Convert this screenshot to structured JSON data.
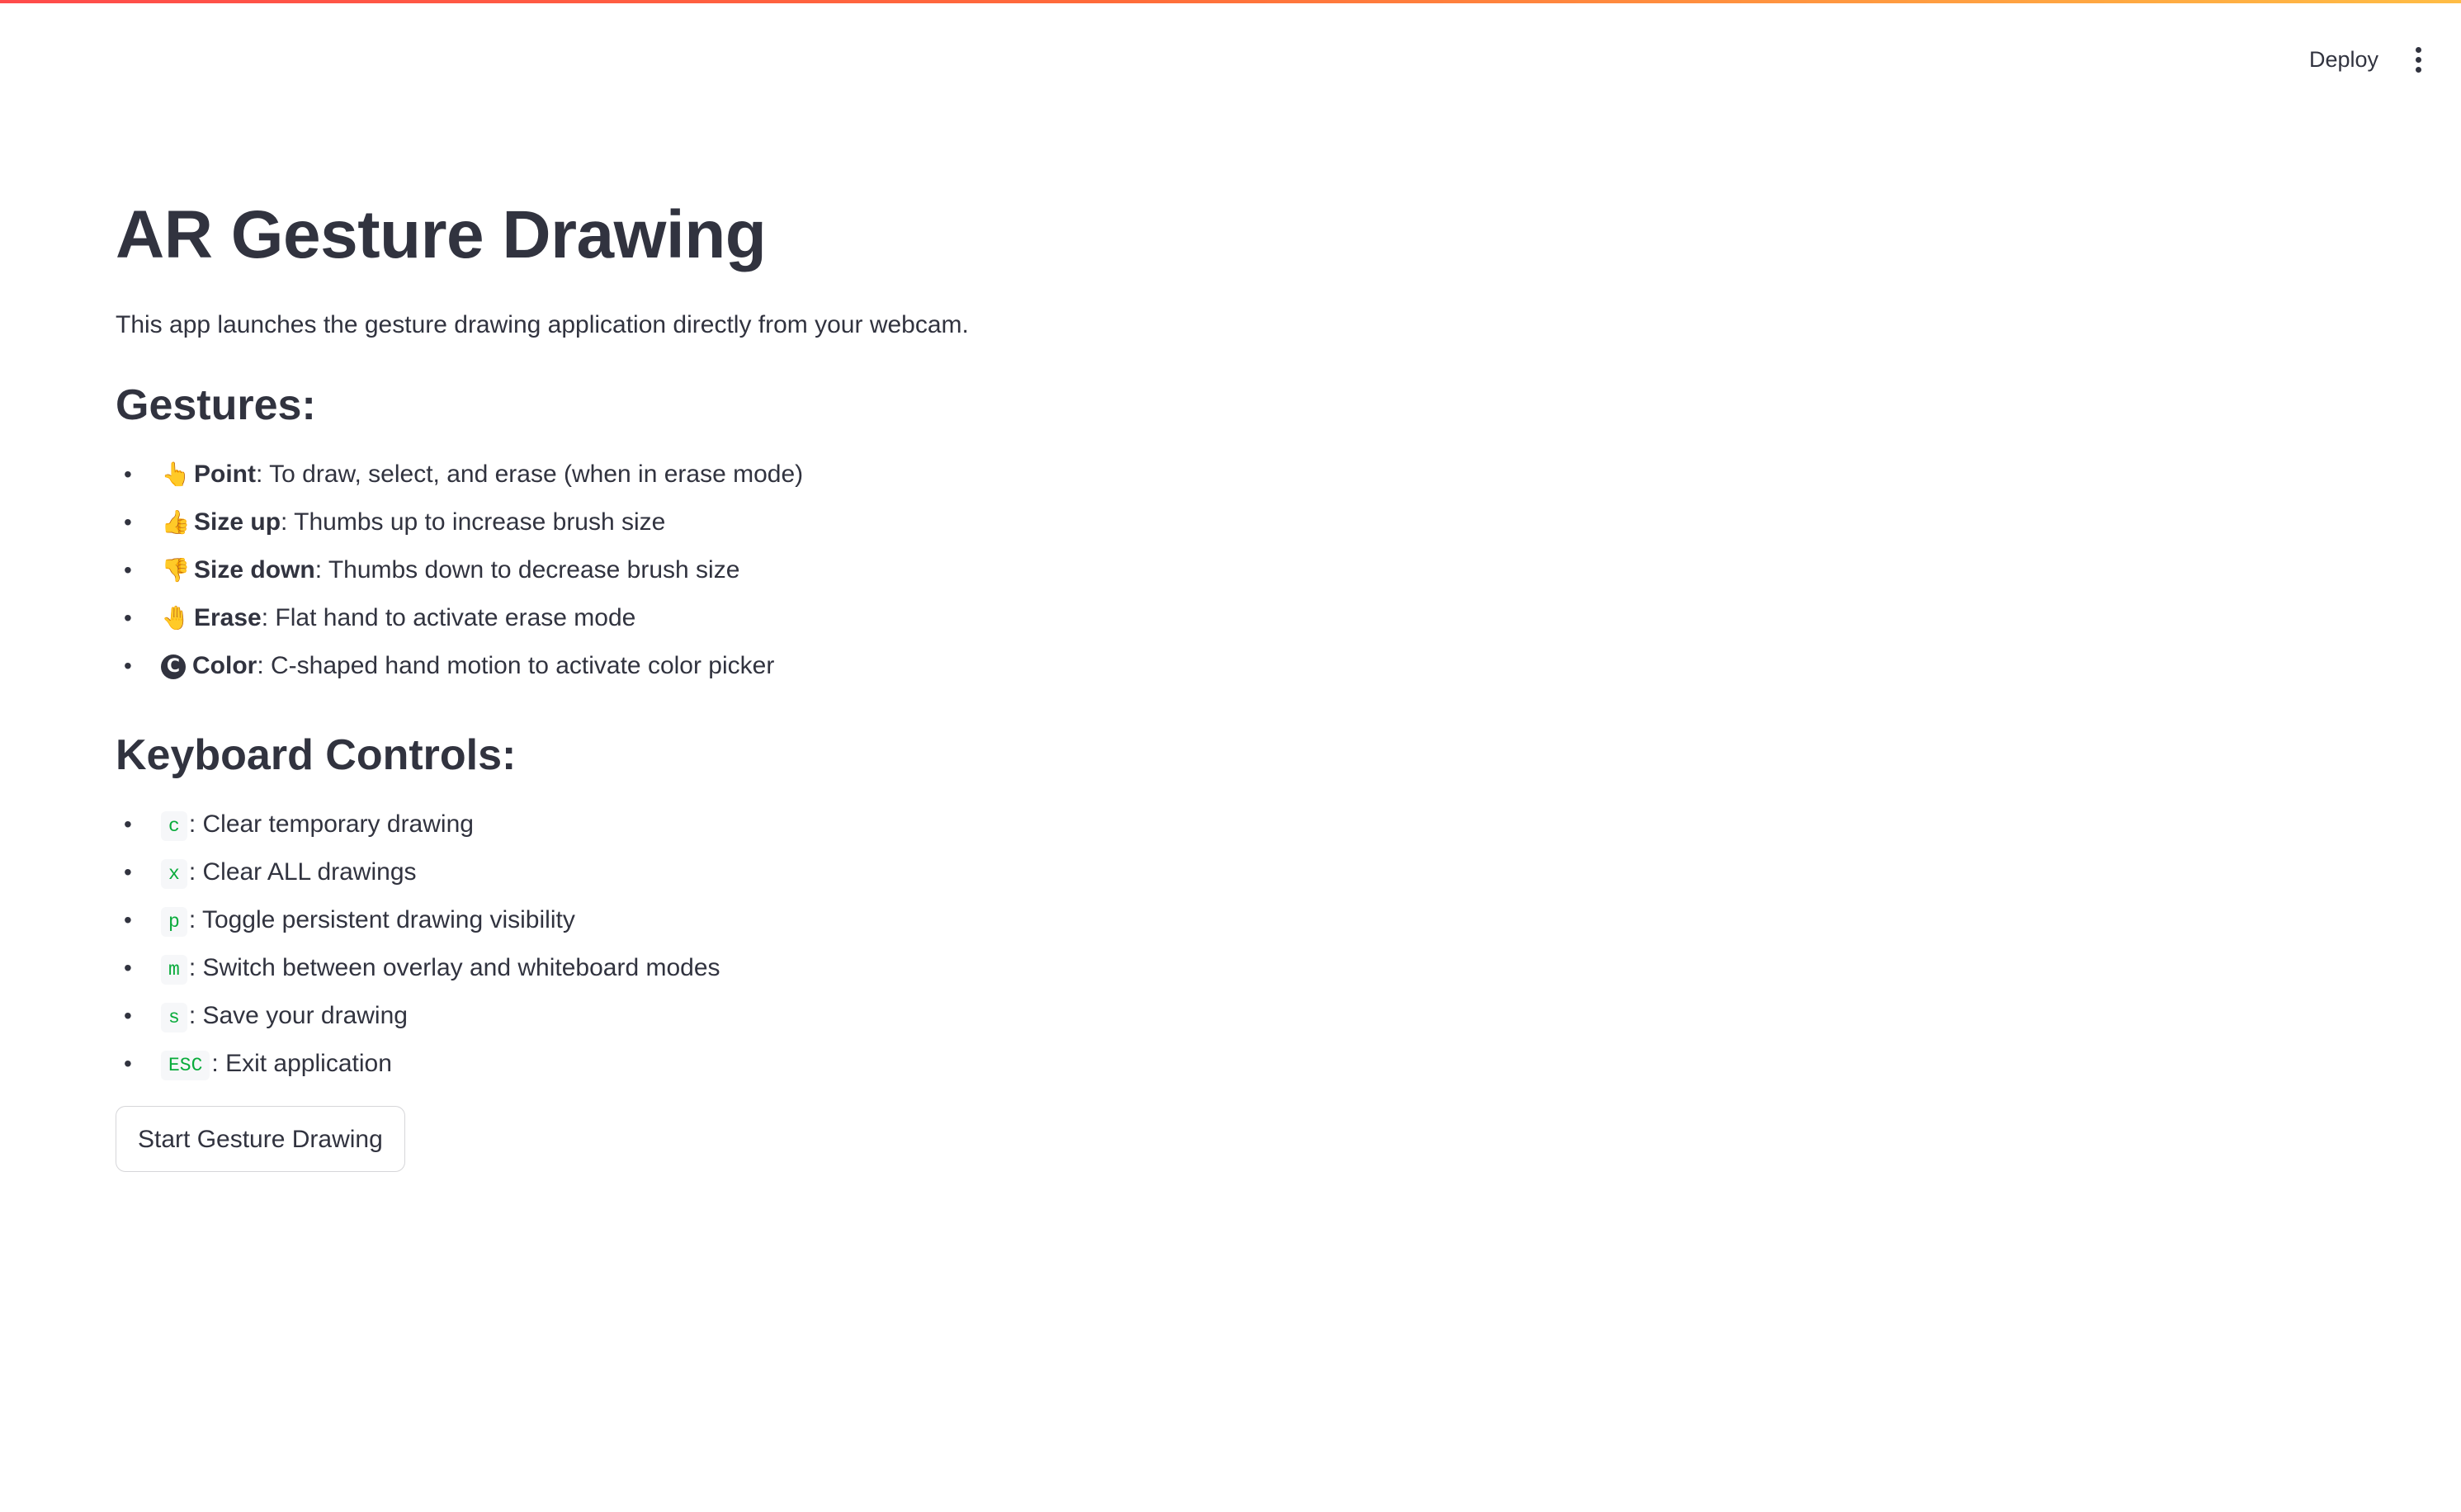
{
  "header": {
    "deploy_label": "Deploy",
    "menu_icon": "more-vertical-icon"
  },
  "colors": {
    "text": "#31333f",
    "code_green": "#09ab3b",
    "decoration_start": "#ff4b4b",
    "decoration_end": "#ffbd45"
  },
  "main": {
    "title": "AR Gesture Drawing",
    "intro": "This app launches the gesture drawing application directly from your webcam.",
    "gestures": {
      "heading": "Gestures:",
      "items": [
        {
          "emoji": "👆",
          "icon": "pointing-hand-icon",
          "term": "Point",
          "description": ": To draw, select, and erase (when in erase mode)"
        },
        {
          "emoji": "👍",
          "icon": "thumbs-up-icon",
          "term": "Size up",
          "description": ": Thumbs up to increase brush size"
        },
        {
          "emoji": "👎",
          "icon": "thumbs-down-icon",
          "term": "Size down",
          "description": ": Thumbs down to decrease brush size"
        },
        {
          "emoji": "🤚",
          "icon": "raised-hand-icon",
          "term": "Erase",
          "description": ": Flat hand to activate erase mode"
        },
        {
          "emoji": "C",
          "icon": "c-circle-icon",
          "term": "Color",
          "description": ": C-shaped hand motion to activate color picker"
        }
      ]
    },
    "keyboard": {
      "heading": "Keyboard Controls:",
      "items": [
        {
          "key": "c",
          "description": ": Clear temporary drawing"
        },
        {
          "key": "x",
          "description": ": Clear ALL drawings"
        },
        {
          "key": "p",
          "description": ": Toggle persistent drawing visibility"
        },
        {
          "key": "m",
          "description": ": Switch between overlay and whiteboard modes"
        },
        {
          "key": "s",
          "description": ": Save your drawing"
        },
        {
          "key": "ESC",
          "description": ": Exit application"
        }
      ]
    },
    "start_button_label": "Start Gesture Drawing"
  }
}
